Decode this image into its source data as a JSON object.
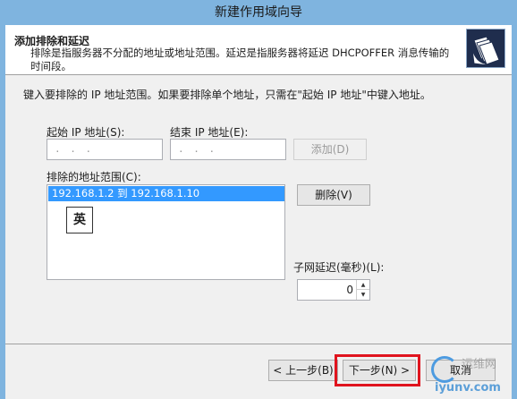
{
  "window": {
    "title": "新建作用域向导"
  },
  "header": {
    "title": "添加排除和延迟",
    "description": "排除是指服务器不分配的地址或地址范围。延迟是指服务器将延迟 DHCPOFFER 消息传输的时间段。",
    "icon": "folder-pages-icon"
  },
  "content": {
    "intro": "键入要排除的 IP 地址范围。如果要排除单个地址，只需在\"起始 IP 地址\"中键入地址。",
    "start_ip": {
      "label": "起始 IP 地址(S):",
      "value": ". . ."
    },
    "end_ip": {
      "label": "结束 IP 地址(E):",
      "value": ". . ."
    },
    "add_button": "添加(D)",
    "excluded_label": "排除的地址范围(C):",
    "excluded_items": [
      "192.168.1.2 到 192.168.1.10"
    ],
    "remove_button": "删除(V)",
    "delay_label": "子网延迟(毫秒)(L):",
    "delay_value": "0",
    "ime_indicator": "英"
  },
  "footer": {
    "back_button": "< 上一步(B)",
    "next_button": "下一步(N) >",
    "cancel_button": "取消"
  },
  "watermark": {
    "line1": "运维网",
    "line2": "iyunv.com"
  },
  "colors": {
    "highlight": "#e0141e",
    "selection": "#3399ff",
    "titlebar": "#7fb4df"
  }
}
